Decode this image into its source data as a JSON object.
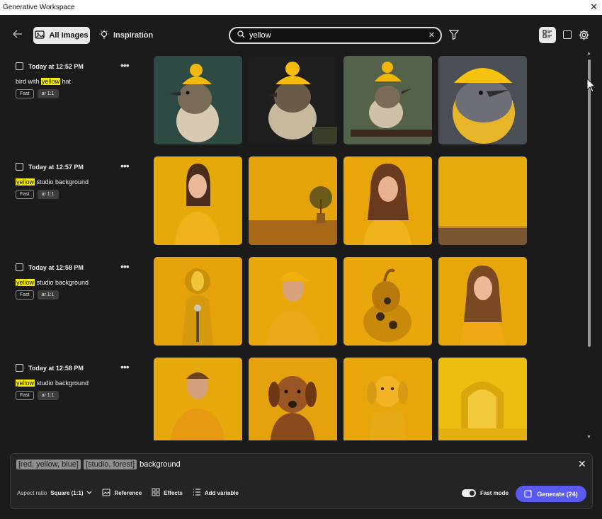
{
  "window": {
    "title": "Generative Workspace",
    "close": "✕"
  },
  "toolbar": {
    "all_images_label": "All images",
    "inspiration_label": "Inspiration",
    "search_value": "yellow"
  },
  "groups": [
    {
      "time": "Today at 12:52 PM",
      "prompt_before": "bird with ",
      "prompt_highlight": "yellow",
      "prompt_after": " hat",
      "tag_fast": "Fast",
      "tag_ar": "ar 1:1",
      "images": [
        "bird-yellow-hat",
        "bird-yellow-hat",
        "bird-yellow-hat-on-branch",
        "bird-yellow-hat-closeup"
      ]
    },
    {
      "time": "Today at 12:57 PM",
      "prompt_before": "",
      "prompt_highlight": "yellow",
      "prompt_after": " studio background",
      "tag_fast": "Fast",
      "tag_ar": "ar 1:1",
      "images": [
        "woman-yellow-sweater",
        "yellow-room-with-plant",
        "woman-yellow-sweater-wavy-hair",
        "empty-yellow-studio-wood-floor"
      ]
    },
    {
      "time": "Today at 12:58 PM",
      "prompt_before": "",
      "prompt_highlight": "yellow",
      "prompt_after": " studio background",
      "tag_fast": "Fast",
      "tag_ar": "ar 1:1",
      "images": [
        "yellow-figure-with-microphone",
        "man-yellow-cap",
        "sunflower-sculpture",
        "smiling-woman-yellow"
      ]
    },
    {
      "time": "Today at 12:58 PM",
      "prompt_before": "",
      "prompt_highlight": "yellow",
      "prompt_after": " studio background",
      "tag_fast": "Fast",
      "tag_ar": "ar 1:1",
      "images": [
        "man-yellow-shirt",
        "brown-dog",
        "yellow-dog-sculpture",
        "yellow-arch-room"
      ]
    }
  ],
  "composer": {
    "chip1": "[red, yellow, blue]",
    "chip2": "[studio, forest]",
    "text": "background",
    "aspect_label": "Aspect ratio",
    "aspect_value": "Square (1:1)",
    "reference_label": "Reference",
    "effects_label": "Effects",
    "add_variable_label": "Add variable",
    "fast_mode_label": "Fast mode",
    "generate_label": "Generate (24)"
  }
}
